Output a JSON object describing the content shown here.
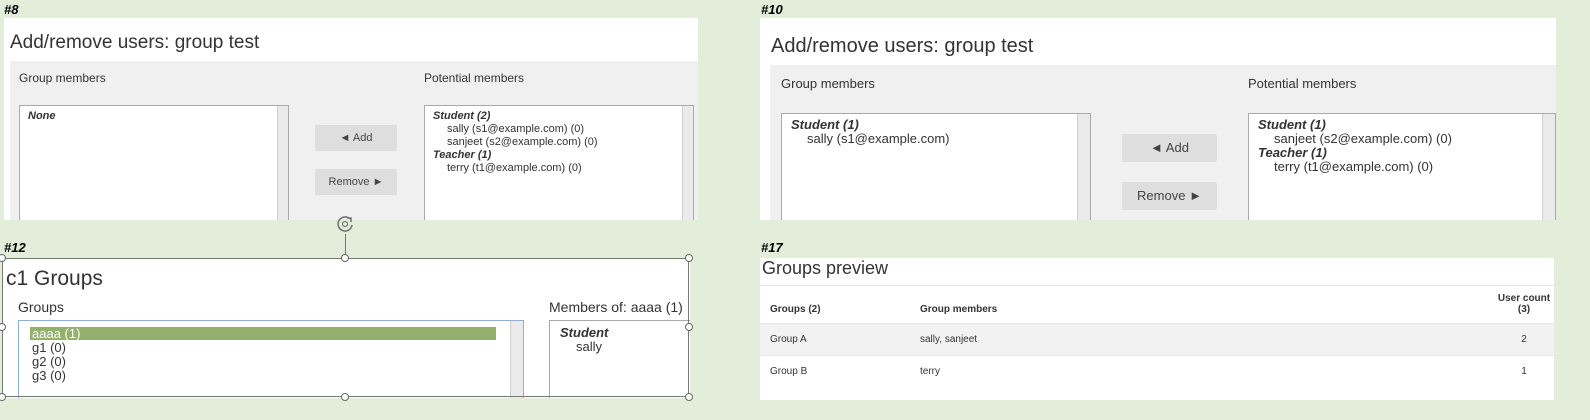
{
  "screens": {
    "s8": {
      "label": "#8",
      "heading": "Add/remove users: group test",
      "group_members_label": "Group members",
      "potential_members_label": "Potential members",
      "group_members": {
        "none": "None"
      },
      "potential": {
        "student_group": "Student (2)",
        "students": [
          "sally (s1@example.com) (0)",
          "sanjeet (s2@example.com) (0)"
        ],
        "teacher_group": "Teacher (1)",
        "teachers": [
          "terry (t1@example.com) (0)"
        ]
      },
      "add_button": "◄ Add",
      "remove_button": "Remove ►"
    },
    "s10": {
      "label": "#10",
      "heading": "Add/remove users: group test",
      "group_members_label": "Group members",
      "potential_members_label": "Potential members",
      "group_members": {
        "student_group": "Student (1)",
        "students": [
          "sally (s1@example.com)"
        ]
      },
      "potential": {
        "student_group": "Student (1)",
        "students": [
          "sanjeet (s2@example.com) (0)"
        ],
        "teacher_group": "Teacher (1)",
        "teachers": [
          "terry (t1@example.com) (0)"
        ]
      },
      "add_button": "◄ Add",
      "remove_button": "Remove ►"
    },
    "s12": {
      "label": "#12",
      "heading": "c1 Groups",
      "groups_label": "Groups",
      "members_label": "Members of: aaaa (1)",
      "groups": [
        "aaaa (1)",
        "g1 (0)",
        "g2 (0)",
        "g3 (0)"
      ],
      "members_group": "Student",
      "members": [
        "sally"
      ]
    },
    "s17": {
      "label": "#17",
      "heading": "Groups preview",
      "columns": [
        "Groups (2)",
        "Group members",
        "User count",
        "(3)"
      ],
      "rows": [
        {
          "group": "Group A",
          "members": "sally, sanjeet",
          "count": "2"
        },
        {
          "group": "Group B",
          "members": "terry",
          "count": "1"
        }
      ]
    }
  }
}
